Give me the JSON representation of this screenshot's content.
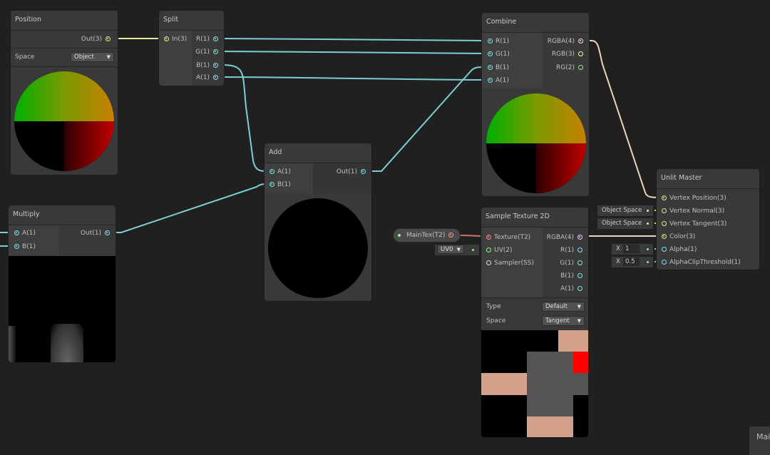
{
  "colors": {
    "background": "#202020",
    "node": "#393939",
    "vector1": "#84e4e7",
    "vector3": "#f6ff9a",
    "vector4": "#fbcbf4",
    "texture": "#ff8b8b",
    "vector2": "#9aef92"
  },
  "nodes": {
    "position": {
      "title": "Position",
      "out": "Out(3)",
      "space_label": "Space",
      "space_value": "Object"
    },
    "split": {
      "title": "Split",
      "in": "In(3)",
      "outs": [
        "R(1)",
        "G(1)",
        "B(1)",
        "A(1)"
      ]
    },
    "combine": {
      "title": "Combine",
      "ins": [
        "R(1)",
        "G(1)",
        "B(1)",
        "A(1)"
      ],
      "outs": [
        "RGBA(4)",
        "RGB(3)",
        "RG(2)"
      ]
    },
    "add": {
      "title": "Add",
      "ins": [
        "A(1)",
        "B(1)"
      ],
      "out": "Out(1)"
    },
    "multiply": {
      "title": "Multiply",
      "ins": [
        "A(1)",
        "B(1)"
      ],
      "out": "Out(1)"
    },
    "sample": {
      "title": "Sample Texture 2D",
      "ins": [
        "Texture(T2)",
        "UV(2)",
        "Sampler(SS)"
      ],
      "outs": [
        "RGBA(4)",
        "R(1)",
        "G(1)",
        "B(1)",
        "A(1)"
      ],
      "type_label": "Type",
      "type_value": "Default",
      "space_label": "Space",
      "space_value": "Tangent"
    },
    "master": {
      "title": "Unlit Master",
      "ins": [
        "Vertex Position(3)",
        "Vertex Normal(3)",
        "Vertex Tangent(3)",
        "Color(3)",
        "Alpha(1)",
        "AlphaClipThreshold(1)"
      ]
    }
  },
  "property": {
    "label": "MainTex(T2)"
  },
  "uv_field": {
    "value": "UV0"
  },
  "defaults": {
    "normal_space": "Object Space",
    "tangent_space": "Object Space",
    "alpha_axis": "X",
    "alpha": "1",
    "clip_axis": "X",
    "clip": "0.5"
  },
  "tab": {
    "label": "Mai"
  }
}
